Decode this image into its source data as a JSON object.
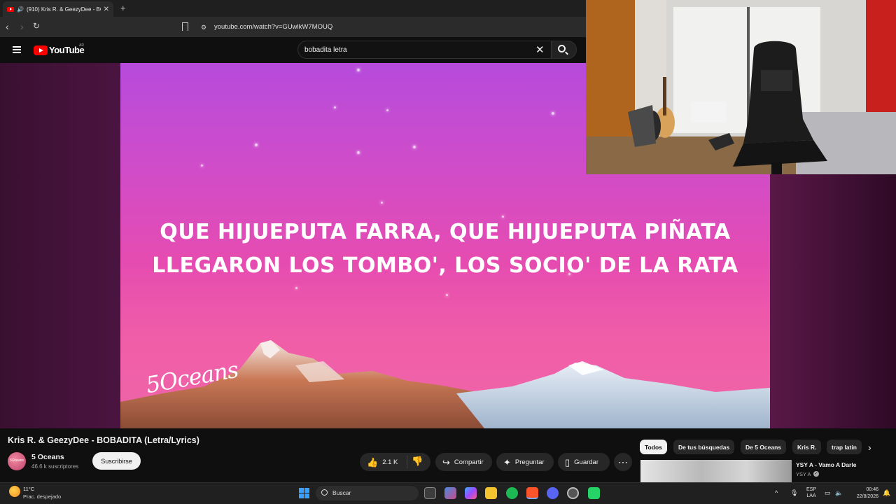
{
  "browser": {
    "tab_title": "(910) Kris R. & GeezyDee - BO",
    "url": "youtube.com/watch?v=GUwlkW7MOUQ"
  },
  "youtube": {
    "wordmark": "YouTube",
    "country": "AR",
    "search_query": "bobadita letra"
  },
  "video": {
    "lyrics_line1": "QUE HIJUEPUTA FARRA, QUE HIJUEPUTA PIÑATA",
    "lyrics_line2": "LLEGARON LOS TOMBO', LOS SOCIO' DE LA RATA",
    "watermark": "5Oceans",
    "title": "Kris R. & GeezyDee - BOBADITA (Letra/Lyrics)"
  },
  "channel": {
    "name": "5 Oceans",
    "subscribers": "46.6 k suscriptores",
    "subscribe_label": "Suscribirse",
    "avatar_text": "5Oceans"
  },
  "actions": {
    "likes": "2.1 K",
    "share_label": "Compartir",
    "ask_label": "Preguntar",
    "save_label": "Guardar"
  },
  "chips": [
    "Todos",
    "De tus búsquedas",
    "De 5 Oceans",
    "Kris R.",
    "trap latin"
  ],
  "recommendation": {
    "title": "YSY A - Vamo A Darle",
    "channel": "YSY A"
  },
  "taskbar": {
    "temperature": "11°C",
    "weather": "Prac. despejado",
    "search_label": "Buscar",
    "lang_1": "ESP",
    "lang_2": "LAA",
    "time": "00:46",
    "date": "22/8/2026"
  },
  "colors": {
    "youtube_red": "#ff0000",
    "video_pink": "#e64cb0",
    "video_purple": "#b64bdc"
  }
}
